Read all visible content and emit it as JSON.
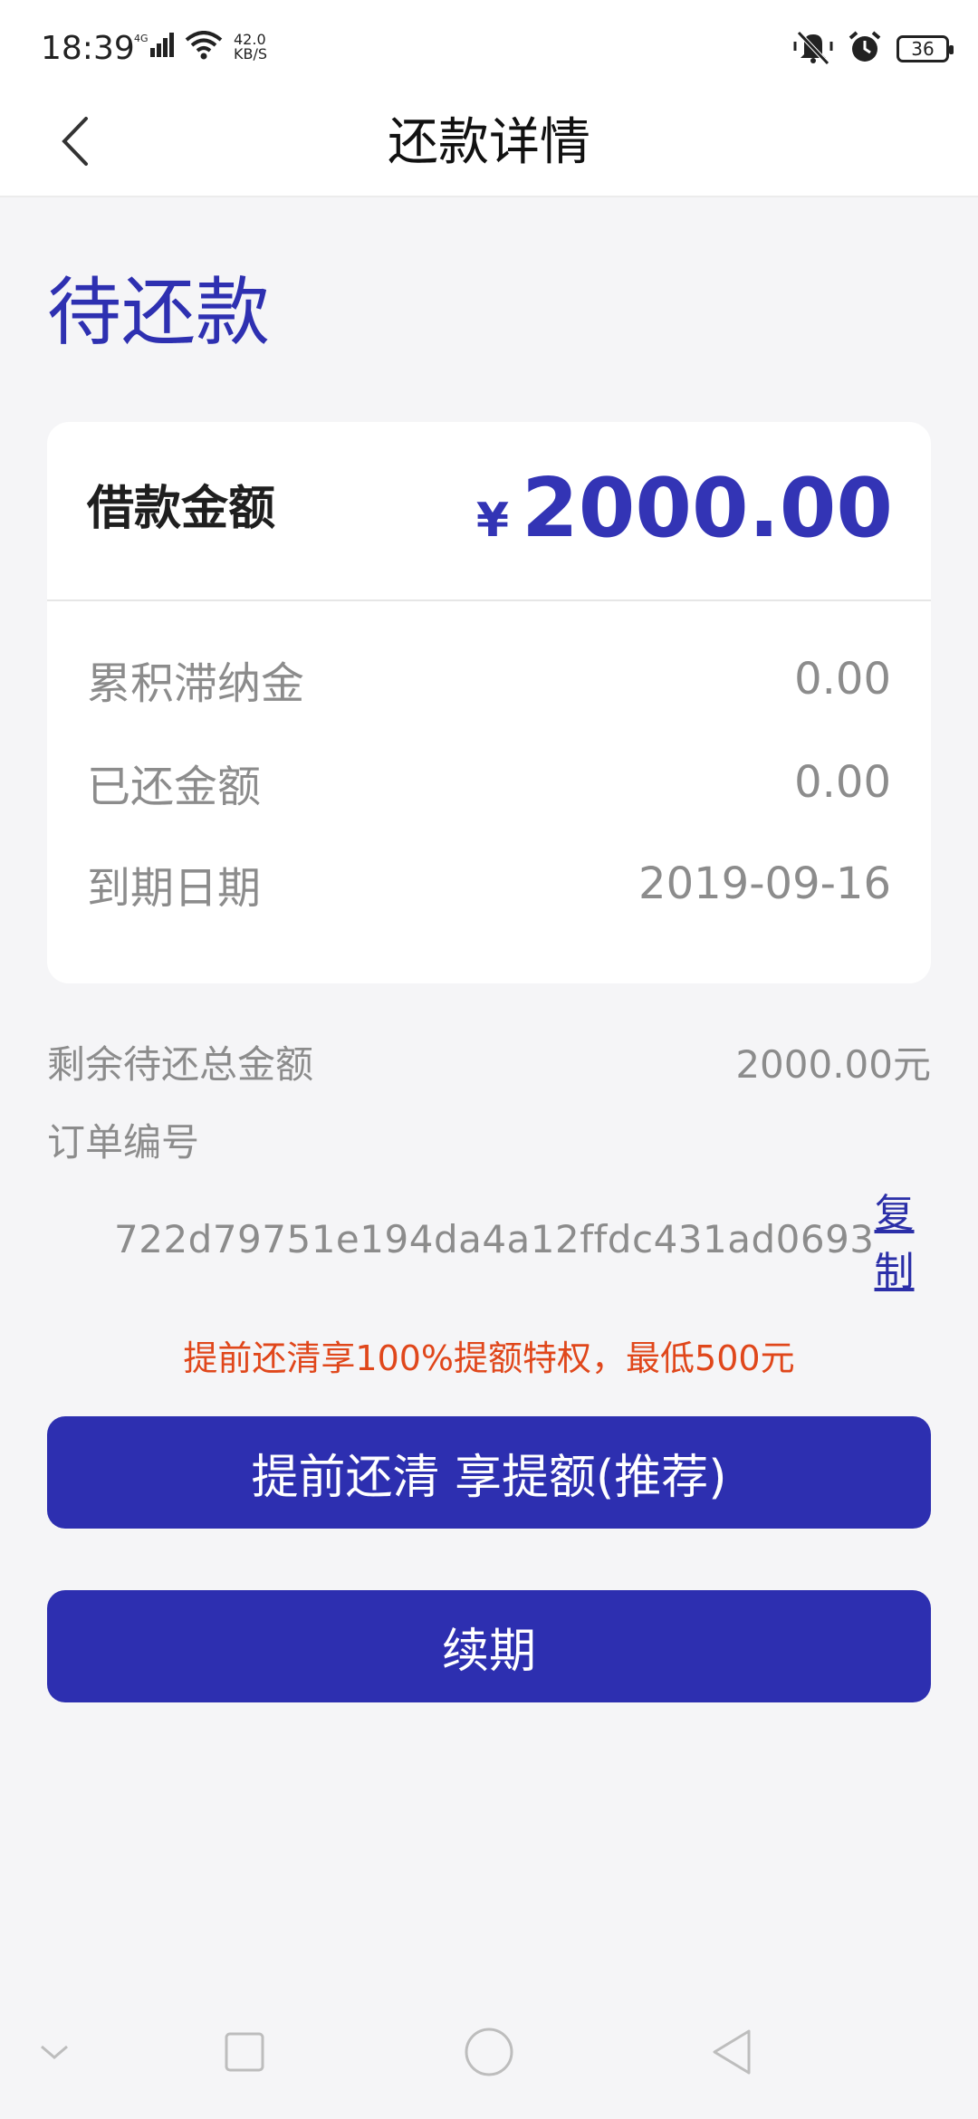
{
  "status_bar": {
    "time": "18:39",
    "network": "4G",
    "speed_value": "42.0",
    "speed_unit": "KB/S",
    "battery": "36"
  },
  "nav": {
    "title": "还款详情"
  },
  "status_heading": "待还款",
  "card": {
    "loan_label": "借款金额",
    "currency_symbol": "¥",
    "loan_amount": "2000.00",
    "rows": [
      {
        "label": "累积滞纳金",
        "value": "0.00"
      },
      {
        "label": "已还金额",
        "value": "0.00"
      },
      {
        "label": "到期日期",
        "value": "2019-09-16"
      }
    ]
  },
  "summary": {
    "remaining_label": "剩余待还总金额",
    "remaining_value": "2000.00元",
    "order_label": "订单编号",
    "order_number": "722d79751e194da4a12ffdc431ad0693",
    "copy_label": "复制"
  },
  "promo_text": "提前还清享100%提额特权，最低500元",
  "buttons": {
    "early_repay_label": "提前还清 享提额(推荐)",
    "renew_label": "续期"
  },
  "colors": {
    "accent": "#2d2fb0",
    "promo": "#e0471b",
    "muted_text": "#8c8c8c"
  }
}
